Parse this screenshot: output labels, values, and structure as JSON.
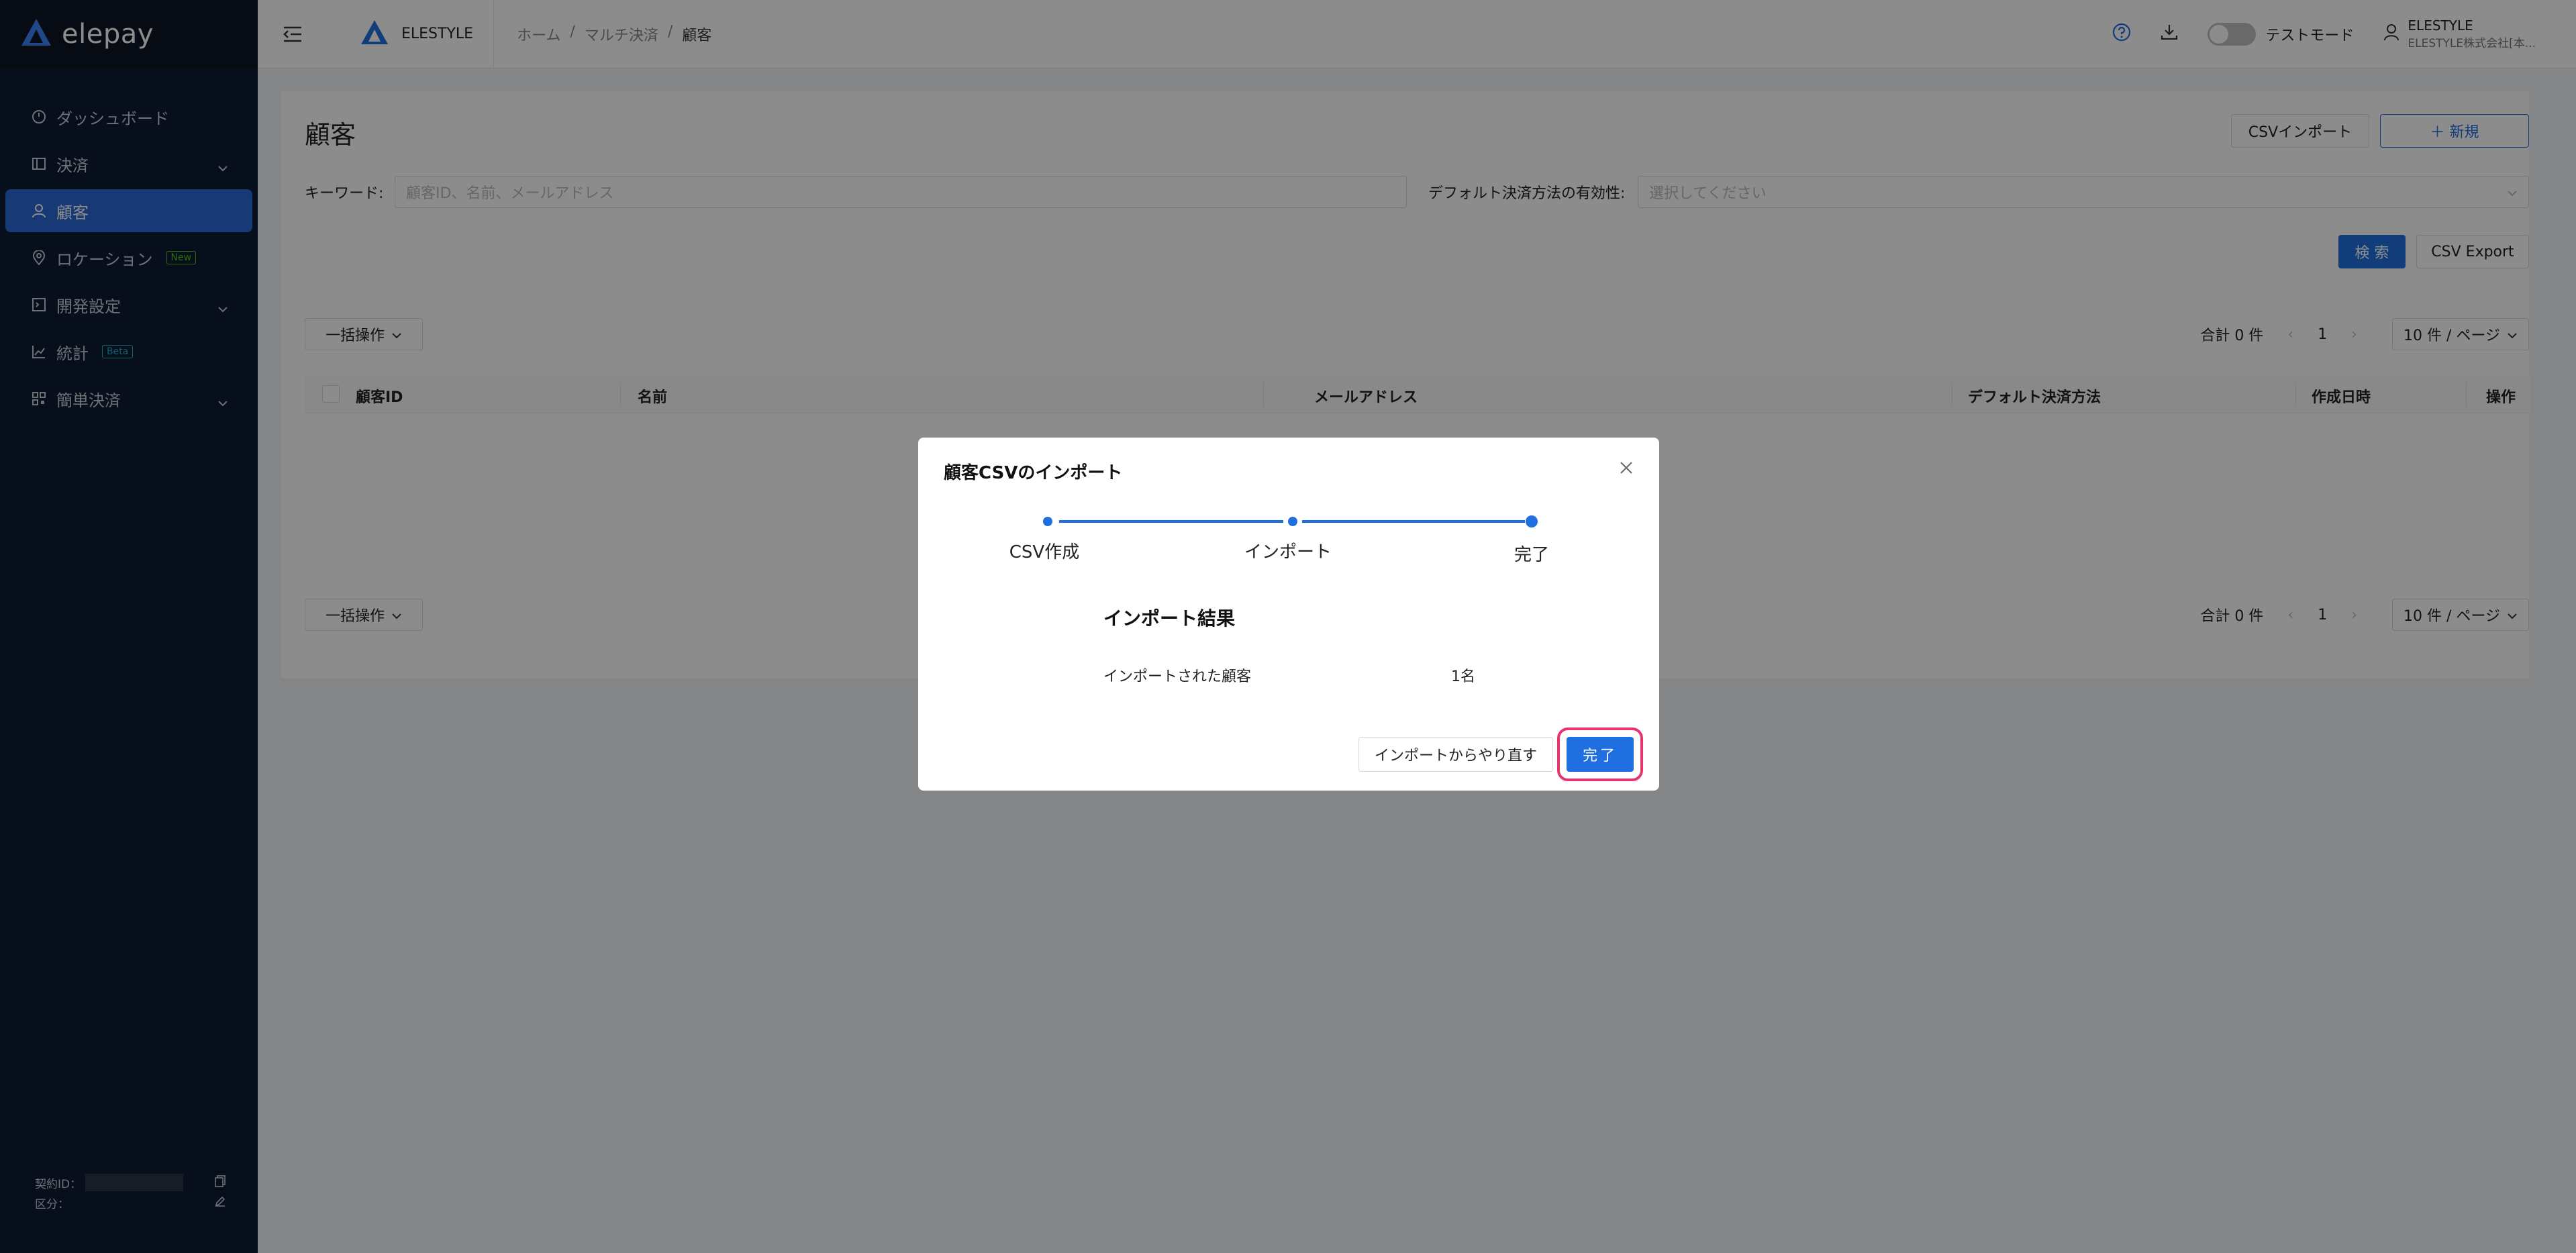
{
  "sidebar": {
    "logo": "elepay",
    "items": [
      {
        "label": "ダッシュボード"
      },
      {
        "label": "決済"
      },
      {
        "label": "顧客"
      },
      {
        "label": "ロケーション",
        "tag": "New"
      },
      {
        "label": "開発設定"
      },
      {
        "label": "統計",
        "tag": "Beta"
      },
      {
        "label": "簡単決済"
      }
    ],
    "footer": {
      "contract_label": "契約ID：",
      "category_label": "区分："
    }
  },
  "header": {
    "org_name": "ELESTYLE",
    "breadcrumb": [
      "ホーム",
      "マルチ決済",
      "顧客"
    ],
    "breadcrumb_sep": "/",
    "test_mode_label": "テストモード",
    "user_name": "ELESTYLE",
    "user_company": "ELESTYLE株式会社[本..."
  },
  "page": {
    "title": "顧客",
    "csv_import_button": "CSVインポート",
    "new_button": "＋ 新規",
    "keyword_label": "キーワード:",
    "keyword_placeholder": "顧客ID、名前、メールアドレス",
    "default_method_label": "デフォルト決済方法の有効性:",
    "default_method_placeholder": "選択してください",
    "search_button": "検 索",
    "csv_export_button": "CSV Export",
    "bulk_action": "一括操作",
    "total": "合計 0 件",
    "page_number": "1",
    "page_size": "10 件 / ページ",
    "table_columns": [
      "顧客ID",
      "名前",
      "メールアドレス",
      "デフォルト決済方法",
      "作成日時",
      "操作"
    ]
  },
  "modal": {
    "title": "顧客CSVのインポート",
    "steps": [
      "CSV作成",
      "インポート",
      "完了"
    ],
    "result_title": "インポート結果",
    "imported_label": "インポートされた顧客",
    "imported_value": "1名",
    "restart_button": "インポートからやり直す",
    "done_button": "完了"
  },
  "colors": {
    "sidebar_bg": "#0f1c33",
    "accent": "#1f6fe0",
    "highlight": "#e8336f"
  }
}
